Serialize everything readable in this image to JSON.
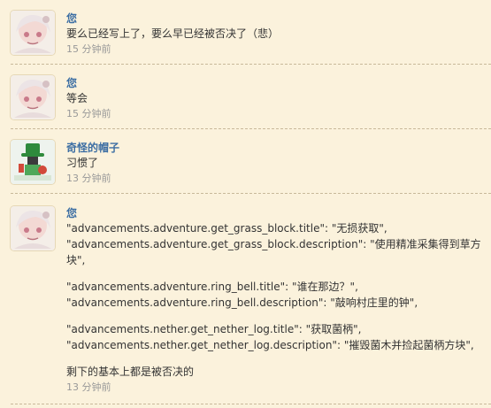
{
  "comments": [
    {
      "author": "您",
      "avatar_icon": "anime-girl-avatar",
      "lines": [
        "要么已经写上了，要么早已经被否决了（悲）"
      ],
      "time": "15 分钟前"
    },
    {
      "author": "您",
      "avatar_icon": "anime-girl-avatar",
      "lines": [
        "等会"
      ],
      "time": "15 分钟前"
    },
    {
      "author": "奇怪的帽子",
      "avatar_icon": "green-hat-figure-avatar",
      "lines": [
        "习惯了"
      ],
      "time": "13 分钟前"
    },
    {
      "author": "您",
      "avatar_icon": "anime-girl-avatar",
      "lines": [
        "\"advancements.adventure.get_grass_block.title\": \"无损获取\",",
        "\"advancements.adventure.get_grass_block.description\": \"使用精准采集得到草方块\",",
        "",
        "\"advancements.adventure.ring_bell.title\": \"谁在那边？\",",
        "\"advancements.adventure.ring_bell.description\": \"敲响村庄里的钟\",",
        "",
        "\"advancements.nether.get_nether_log.title\": \"获取菌柄\",",
        "\"advancements.nether.get_nether_log.description\": \"摧毁菌木并捡起菌柄方块\",",
        "",
        "剩下的基本上都是被否决的"
      ],
      "time": "13 分钟前"
    }
  ],
  "colors": {
    "background": "#fbf2dc",
    "author": "#3c6ea3",
    "text": "#333333",
    "time": "#999999",
    "divider": "#c8b99a"
  }
}
